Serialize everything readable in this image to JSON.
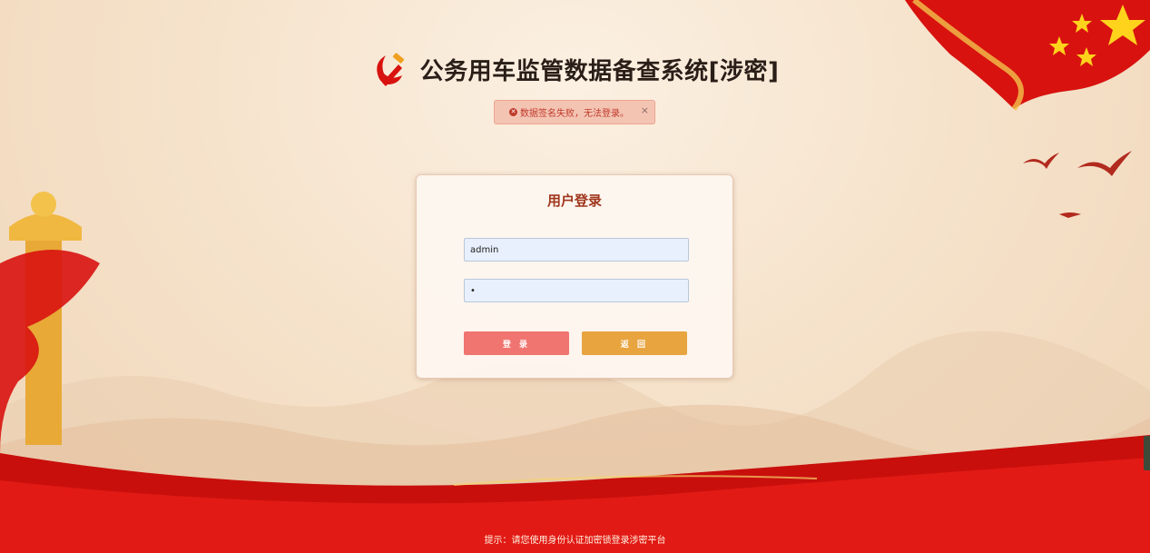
{
  "header": {
    "title": "公务用车监管数据备查系统[涉密]"
  },
  "alert": {
    "message": "数据签名失败，无法登录。",
    "close_symbol": "×",
    "status_color": "#c0392b"
  },
  "login": {
    "title": "用户登录",
    "username_value": "admin",
    "password_value": "•",
    "login_label": "登 录",
    "back_label": "返 回"
  },
  "footer": {
    "hint": "提示：请您使用身份认证加密锁登录涉密平台"
  },
  "colors": {
    "accent_red": "#d8120f",
    "login_button": "#f07470",
    "back_button": "#e8a43f",
    "title_red": "#a0361c"
  }
}
